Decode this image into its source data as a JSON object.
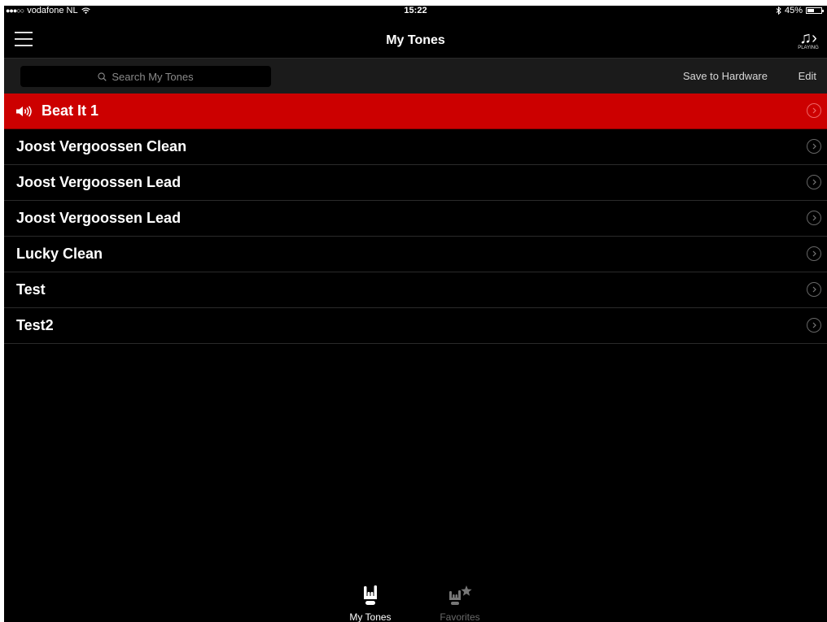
{
  "statusbar": {
    "carrier": "vodafone NL",
    "time": "15:22",
    "battery": "45%"
  },
  "nav": {
    "title": "My Tones",
    "playing_caption": "PLAYING"
  },
  "toolbar": {
    "search_placeholder": "Search My Tones",
    "save_label": "Save to Hardware",
    "edit_label": "Edit"
  },
  "tones": [
    {
      "label": "Beat It 1"
    },
    {
      "label": "Joost Vergoossen Clean"
    },
    {
      "label": "Joost Vergoossen Lead"
    },
    {
      "label": "Joost Vergoossen Lead"
    },
    {
      "label": "Lucky Clean"
    },
    {
      "label": "Test"
    },
    {
      "label": "Test2"
    }
  ],
  "tabs": {
    "my_tones": "My Tones",
    "favorites": "Favorites"
  },
  "colors": {
    "accent": "#cc0000",
    "background": "#000000",
    "toolbar": "#1b1b1b"
  }
}
